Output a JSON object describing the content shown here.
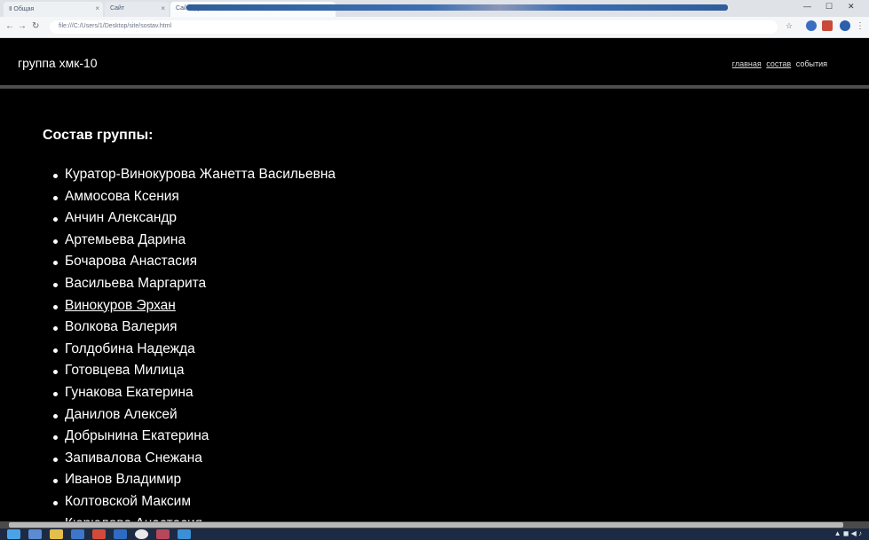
{
  "browser": {
    "tabs": [
      {
        "label": "Ⅱ Общая"
      },
      {
        "label": "Сайт"
      },
      {
        "label": "Сайт группы"
      }
    ],
    "url": "file:///C:/Users/1/Desktop/site/sostav.html"
  },
  "site": {
    "title": "группа хмк-10",
    "nav": {
      "home": "главная",
      "roster": "состав",
      "events": "события"
    }
  },
  "main": {
    "heading": "Состав группы:",
    "members": [
      "Куратор-Винокурова Жанетта Васильевна",
      "Аммосова Ксения",
      "Анчин Александр",
      "Артемьева Дарина",
      "Бочарова Анастасия",
      "Васильева Маргарита",
      "Винокуров Эрхан",
      "Волкова Валерия",
      "Голдобина Надежда",
      "Готовцева Милица",
      "Гунакова Екатерина",
      "Данилов Алексей",
      "Добрынина Екатерина",
      "Запивалова Снежана",
      "Иванов Владимир",
      "Колтовской Максим",
      "Кюрюлова Анастасия"
    ]
  },
  "colors": {
    "page_bg": "#000000",
    "text": "#ffffff",
    "header_rule": "#4d4d4d",
    "taskbar": "#1c2a44"
  }
}
